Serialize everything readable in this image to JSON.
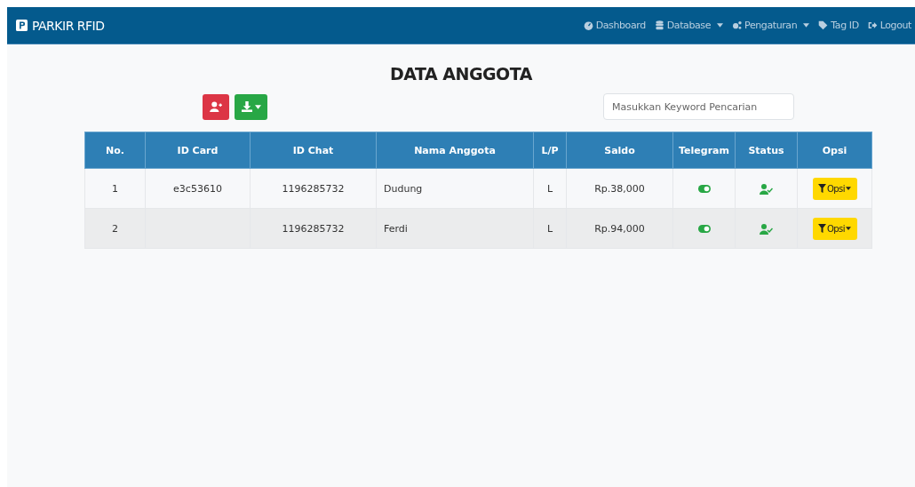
{
  "navbar": {
    "brand": "PARKIR RFID",
    "links": [
      {
        "label": "Dashboard",
        "kind": "dashboard",
        "dropdown": false
      },
      {
        "label": "Database",
        "kind": "database",
        "dropdown": true
      },
      {
        "label": "Pengaturan",
        "kind": "settings",
        "dropdown": true
      },
      {
        "label": "Tag ID",
        "kind": "tag",
        "dropdown": false
      },
      {
        "label": "Logout",
        "kind": "logout",
        "dropdown": false
      }
    ]
  },
  "title": "DATA ANGGOTA",
  "search": {
    "placeholder": "Masukkan Keyword Pencarian"
  },
  "table": {
    "columns": [
      "No.",
      "ID Card",
      "ID Chat",
      "Nama Anggota",
      "L/P",
      "Saldo",
      "Telegram",
      "Status",
      "Opsi"
    ],
    "rows": [
      {
        "no": "1",
        "id_card": "e3c53610",
        "id_chat": "1196285732",
        "nama": "Dudung",
        "lp": "L",
        "saldo": "Rp.38,000",
        "telegram_on": true,
        "status_active": true,
        "opsi": "Opsi"
      },
      {
        "no": "2",
        "id_card": "",
        "id_chat": "1196285732",
        "nama": "Ferdi",
        "lp": "L",
        "saldo": "Rp.94,000",
        "telegram_on": true,
        "status_active": true,
        "opsi": "Opsi"
      }
    ]
  }
}
